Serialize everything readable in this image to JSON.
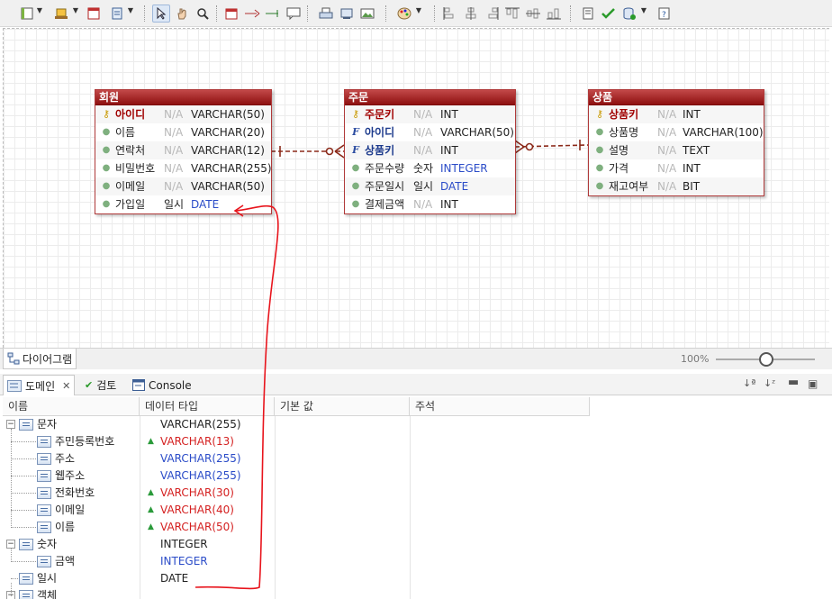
{
  "toolbar": {
    "icons": [
      "layout-icon",
      "memo-icon",
      "table-icon",
      "view-icon",
      "select-icon",
      "hand-icon",
      "zoom-icon",
      "new-table-icon",
      "relation-1n-icon",
      "relation-11-icon",
      "note-icon",
      "print-icon",
      "copy-image-icon",
      "image-icon",
      "color-icon",
      "align-left-icon",
      "align-center-icon",
      "align-right-icon",
      "align-top-icon",
      "align-middle-icon",
      "align-bottom-icon",
      "validate-icon",
      "check-icon",
      "ddl-icon",
      "help-icon"
    ]
  },
  "entities": {
    "member": {
      "title": "회원",
      "rows": [
        {
          "name": "아이디",
          "null": "N/A",
          "type": "VARCHAR(50)",
          "key": "pk"
        },
        {
          "name": "이름",
          "null": "N/A",
          "type": "VARCHAR(20)",
          "key": ""
        },
        {
          "name": "연락처",
          "null": "N/A",
          "type": "VARCHAR(12)",
          "key": ""
        },
        {
          "name": "비밀번호",
          "null": "N/A",
          "type": "VARCHAR(255)",
          "key": ""
        },
        {
          "name": "이메일",
          "null": "N/A",
          "type": "VARCHAR(50)",
          "key": ""
        },
        {
          "name": "가입일",
          "null": "일시",
          "type": "DATE",
          "key": "domain"
        }
      ]
    },
    "order": {
      "title": "주문",
      "rows": [
        {
          "name": "주문키",
          "null": "N/A",
          "type": "INT",
          "key": "pk"
        },
        {
          "name": "아이디",
          "null": "N/A",
          "type": "VARCHAR(50)",
          "key": "fk"
        },
        {
          "name": "상품키",
          "null": "N/A",
          "type": "INT",
          "key": "fk"
        },
        {
          "name": "주문수량",
          "null": "숫자",
          "type": "INTEGER",
          "key": "domain"
        },
        {
          "name": "주문일시",
          "null": "일시",
          "type": "DATE",
          "key": "domain"
        },
        {
          "name": "결제금액",
          "null": "N/A",
          "type": "INT",
          "key": ""
        }
      ]
    },
    "product": {
      "title": "상품",
      "rows": [
        {
          "name": "상품키",
          "null": "N/A",
          "type": "INT",
          "key": "pk"
        },
        {
          "name": "상품명",
          "null": "N/A",
          "type": "VARCHAR(100)",
          "key": ""
        },
        {
          "name": "설명",
          "null": "N/A",
          "type": "TEXT",
          "key": ""
        },
        {
          "name": "가격",
          "null": "N/A",
          "type": "INT",
          "key": ""
        },
        {
          "name": "재고여부",
          "null": "N/A",
          "type": "BIT",
          "key": ""
        }
      ]
    }
  },
  "diagram_tab": {
    "label": "다이어그램"
  },
  "zoom": {
    "label": "100%"
  },
  "view_tabs": {
    "domain": "도메인",
    "review": "검토",
    "console": "Console"
  },
  "domain_table": {
    "columns": [
      "이름",
      "데이터 타입",
      "기본 값",
      "주석"
    ],
    "rows": [
      {
        "name": "문자",
        "type": "VARCHAR(255)",
        "level": 0,
        "expander": "⊟",
        "flag": false,
        "style": "plain"
      },
      {
        "name": "주민등록번호",
        "type": "VARCHAR(13)",
        "level": 1,
        "expander": "",
        "flag": true,
        "style": "red"
      },
      {
        "name": "주소",
        "type": "VARCHAR(255)",
        "level": 1,
        "expander": "",
        "flag": false,
        "style": "blue"
      },
      {
        "name": "웹주소",
        "type": "VARCHAR(255)",
        "level": 1,
        "expander": "",
        "flag": false,
        "style": "blue"
      },
      {
        "name": "전화번호",
        "type": "VARCHAR(30)",
        "level": 1,
        "expander": "",
        "flag": true,
        "style": "red"
      },
      {
        "name": "이메일",
        "type": "VARCHAR(40)",
        "level": 1,
        "expander": "",
        "flag": true,
        "style": "red"
      },
      {
        "name": "이름",
        "type": "VARCHAR(50)",
        "level": 1,
        "expander": "",
        "flag": true,
        "style": "red"
      },
      {
        "name": "숫자",
        "type": "INTEGER",
        "level": 0,
        "expander": "⊟",
        "flag": false,
        "style": "plain"
      },
      {
        "name": "금액",
        "type": "INTEGER",
        "level": 1,
        "expander": "",
        "flag": false,
        "style": "blue"
      },
      {
        "name": "일시",
        "type": "DATE",
        "level": 0,
        "expander": "",
        "flag": false,
        "style": "plain"
      },
      {
        "name": "객체",
        "type": "",
        "level": 0,
        "expander": "⊟",
        "flag": false,
        "style": "plain"
      }
    ]
  },
  "colors": {
    "entity_header": "#9e1a1a",
    "domain_blue": "#2b4cc8",
    "domain_red": "#d42020",
    "annotation": "#e8141c",
    "relation": "#8b2a1a"
  }
}
